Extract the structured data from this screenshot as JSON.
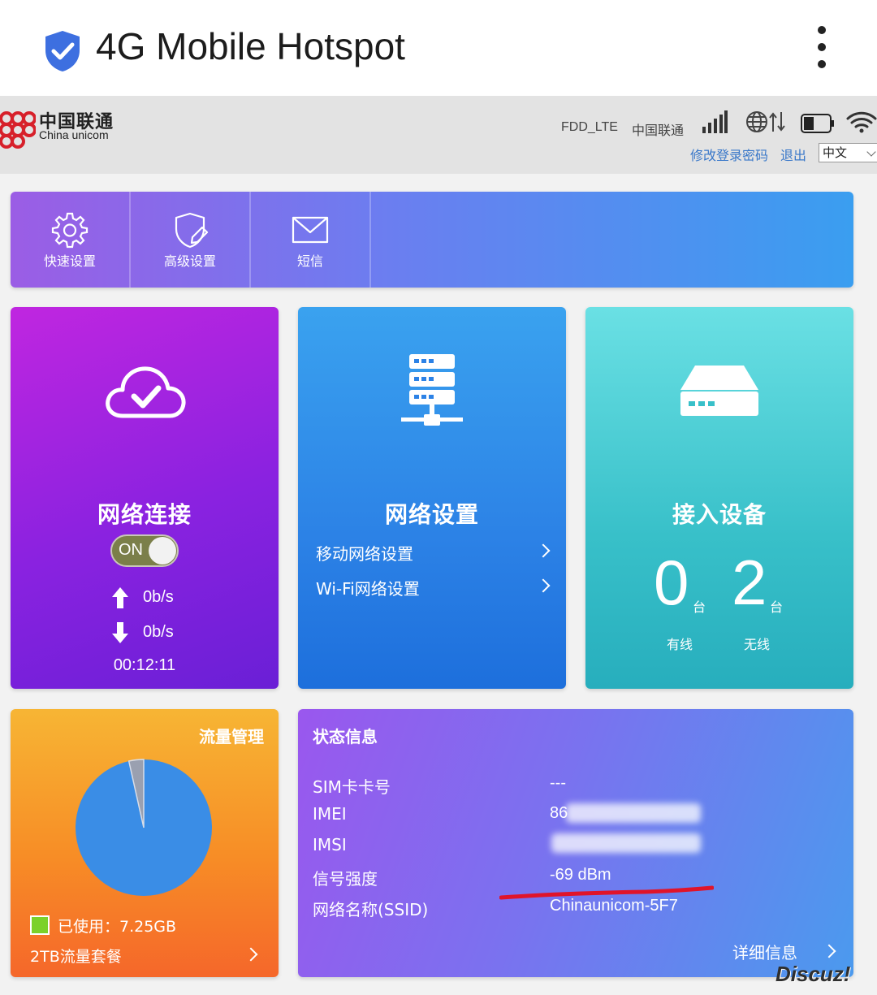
{
  "app_bar": {
    "title": "4G Mobile Hotspot",
    "shield_icon": "shield-check-icon",
    "menu_icon": "more-vert-icon"
  },
  "header": {
    "logo_cn": "中国联通",
    "logo_en": "China unicom",
    "network_type": "FDD_LTE",
    "operator": "中国联通",
    "change_password": "修改登录密码",
    "logout": "退出",
    "language": "中文",
    "brand_color": "#d7202a"
  },
  "menu": {
    "items": [
      {
        "label": "快速设置",
        "icon": "gear-icon"
      },
      {
        "label": "高级设置",
        "icon": "shield-edit-icon"
      },
      {
        "label": "短信",
        "icon": "envelope-icon"
      }
    ]
  },
  "connection": {
    "title": "网络连接",
    "toggle": "ON",
    "upload": "0b/s",
    "download": "0b/s",
    "duration": "00:12:11"
  },
  "network": {
    "title": "网络设置",
    "links": [
      {
        "label": "移动网络设置"
      },
      {
        "label": "Wi-Fi网络设置"
      }
    ]
  },
  "devices": {
    "title": "接入设备",
    "wired_count": "0",
    "wireless_count": "2",
    "unit": "台",
    "wired_label": "有线",
    "wireless_label": "无线"
  },
  "flow": {
    "title": "流量管理",
    "used_label": "已使用：7.25GB",
    "plan": "2TB流量套餐",
    "used_fraction": 0.035
  },
  "status": {
    "title": "状态信息",
    "rows": [
      {
        "label": "SIM卡卡号",
        "value": "---"
      },
      {
        "label": "IMEI",
        "value": "86"
      },
      {
        "label": "IMSI",
        "value": ""
      },
      {
        "label": "信号强度",
        "value": "-69 dBm"
      },
      {
        "label": "网络名称(SSID)",
        "value": "Chinaunicom-5F7"
      }
    ],
    "detail": "详细信息"
  },
  "watermark": "Discuz!"
}
